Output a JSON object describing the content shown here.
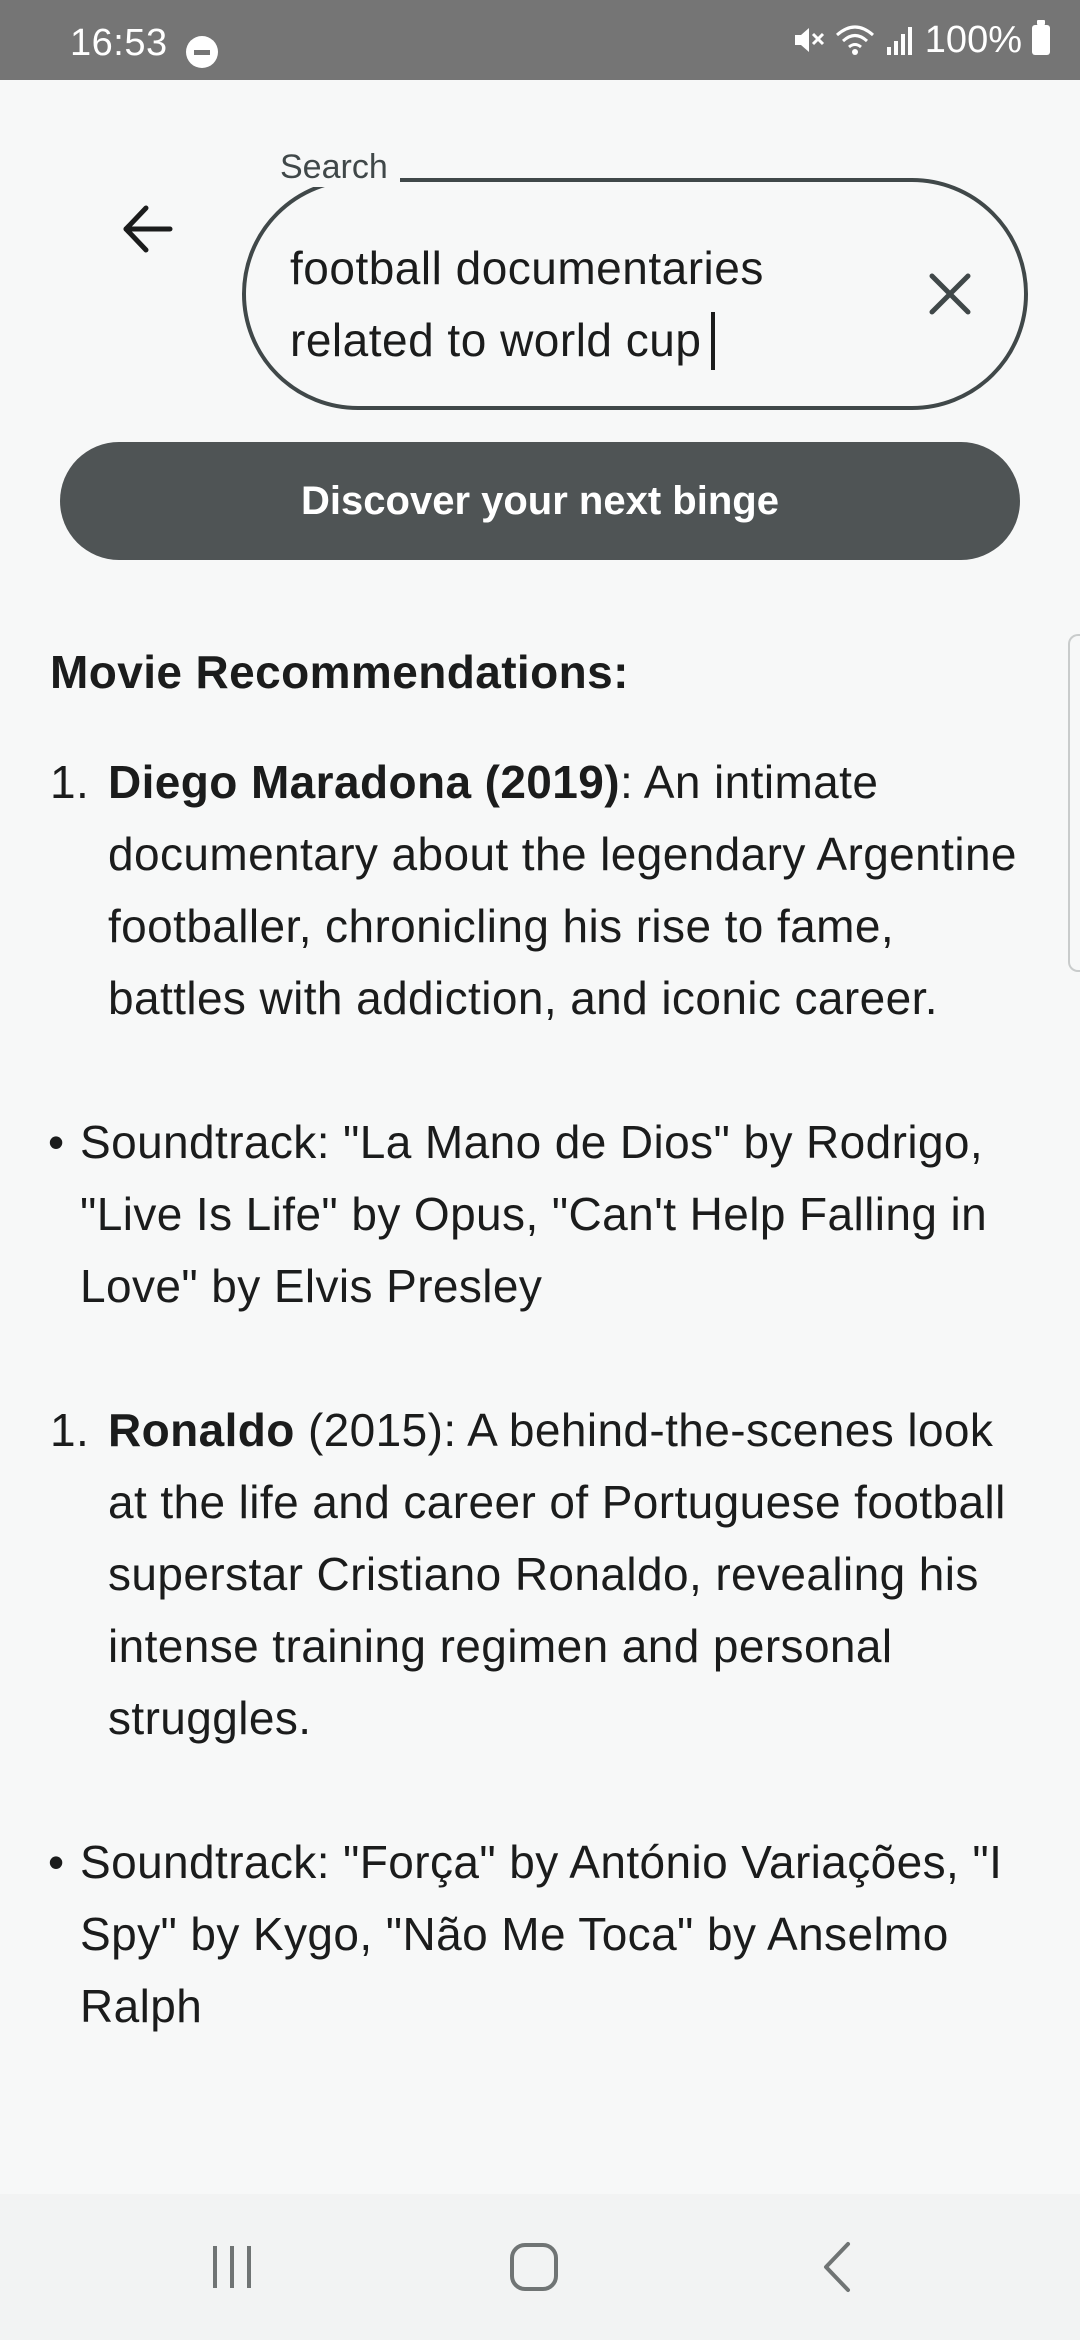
{
  "status_bar": {
    "time": "16:53",
    "battery": "100%"
  },
  "search": {
    "label": "Search",
    "value": "football documentaries related to world cup"
  },
  "discover_button": {
    "label": "Discover your next binge"
  },
  "recommendations": {
    "heading": "Movie Recommendations:",
    "movie_1": {
      "number": "1.",
      "title": "Diego Maradona (2019)",
      "description": ": An intimate documentary about the legendary Argentine footballer, chronicling his rise to fame, battles with addiction, and iconic career."
    },
    "soundtrack_1": {
      "bullet": "•",
      "text": "Soundtrack: \"La Mano de Dios\" by Rodrigo, \"Live Is Life\" by Opus, \"Can't Help Falling in Love\" by Elvis Presley"
    },
    "movie_2": {
      "number": "1.",
      "title": "Ronaldo",
      "description": " (2015): A behind-the-scenes look at the life and career of Portuguese football superstar Cristiano Ronaldo, revealing his intense training regimen and personal struggles."
    },
    "soundtrack_2": {
      "bullet": "•",
      "text": "Soundtrack: \"Força\" by António Variações, \"I Spy\" by Kygo, \"Não Me Toca\" by Anselmo Ralph"
    }
  },
  "icons": {
    "back": "arrow-back-icon",
    "clear": "close-icon",
    "recents": "recents-icon",
    "home": "home-icon",
    "nav_back": "chevron-left-icon"
  },
  "colors": {
    "status_bar": "#757575",
    "button": "#4f5455",
    "outline": "#404849",
    "background": "#f7f8f8"
  }
}
